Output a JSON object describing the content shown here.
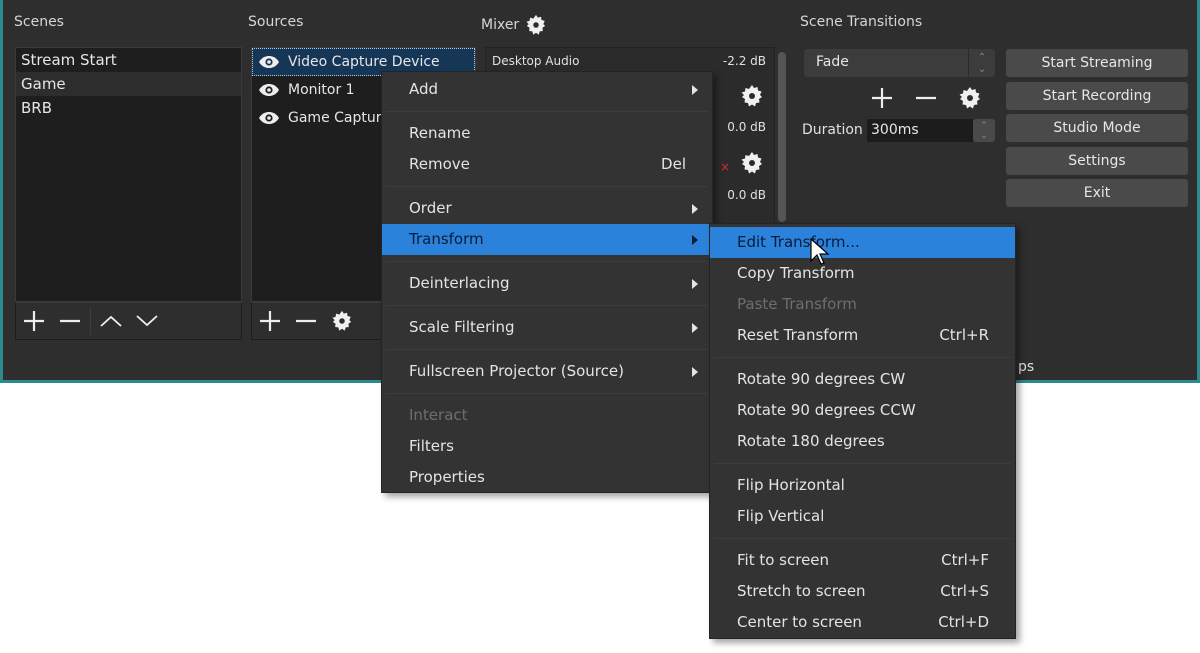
{
  "panels": {
    "scenes_title": "Scenes",
    "sources_title": "Sources",
    "mixer_title": "Mixer",
    "transitions_title": "Scene Transitions"
  },
  "scenes": {
    "items": [
      {
        "label": "Stream Start",
        "selected": false
      },
      {
        "label": "Game",
        "selected": true
      },
      {
        "label": "BRB",
        "selected": false
      }
    ]
  },
  "sources": {
    "items": [
      {
        "label": "Video Capture Device",
        "visible": true,
        "selected": true
      },
      {
        "label": "Monitor 1",
        "visible": true,
        "selected": false
      },
      {
        "label": "Game Capture",
        "visible": true,
        "selected": false
      }
    ]
  },
  "mixer": {
    "channels": [
      {
        "name": "Desktop Audio",
        "level": "-2.2 dB"
      },
      {
        "name": "",
        "level": "0.0 dB"
      },
      {
        "name": "",
        "level": "0.0 dB"
      }
    ]
  },
  "transitions": {
    "selected": "Fade",
    "duration_label": "Duration",
    "duration_value": "300ms"
  },
  "controls": {
    "buttons": [
      "Start Streaming",
      "Start Recording",
      "Studio Mode",
      "Settings",
      "Exit"
    ],
    "partial_label": "ps"
  },
  "context_menu": {
    "items": [
      {
        "label": "Add",
        "submenu": true
      },
      {
        "sep": true
      },
      {
        "label": "Rename"
      },
      {
        "label": "Remove",
        "shortcut": "Del"
      },
      {
        "sep": true
      },
      {
        "label": "Order",
        "submenu": true
      },
      {
        "label": "Transform",
        "submenu": true,
        "highlighted": true
      },
      {
        "sep": true
      },
      {
        "label": "Deinterlacing",
        "submenu": true
      },
      {
        "sep": true
      },
      {
        "label": "Scale Filtering",
        "submenu": true
      },
      {
        "sep": true
      },
      {
        "label": "Fullscreen Projector (Source)",
        "submenu": true
      },
      {
        "sep": true
      },
      {
        "label": "Interact",
        "disabled": true
      },
      {
        "label": "Filters"
      },
      {
        "label": "Properties"
      }
    ]
  },
  "transform_menu": {
    "items": [
      {
        "label": "Edit Transform...",
        "highlighted": true
      },
      {
        "label": "Copy Transform"
      },
      {
        "label": "Paste Transform",
        "disabled": true
      },
      {
        "label": "Reset Transform",
        "shortcut": "Ctrl+R"
      },
      {
        "sep": true
      },
      {
        "label": "Rotate 90 degrees CW"
      },
      {
        "label": "Rotate 90 degrees CCW"
      },
      {
        "label": "Rotate 180 degrees"
      },
      {
        "sep": true
      },
      {
        "label": "Flip Horizontal"
      },
      {
        "label": "Flip Vertical"
      },
      {
        "sep": true
      },
      {
        "label": "Fit to screen",
        "shortcut": "Ctrl+F"
      },
      {
        "label": "Stretch to screen",
        "shortcut": "Ctrl+S"
      },
      {
        "label": "Center to screen",
        "shortcut": "Ctrl+D"
      }
    ]
  },
  "colors": {
    "accent": "#2a82da",
    "window_border": "#2a8a8e",
    "background": "#2e2e2e"
  }
}
